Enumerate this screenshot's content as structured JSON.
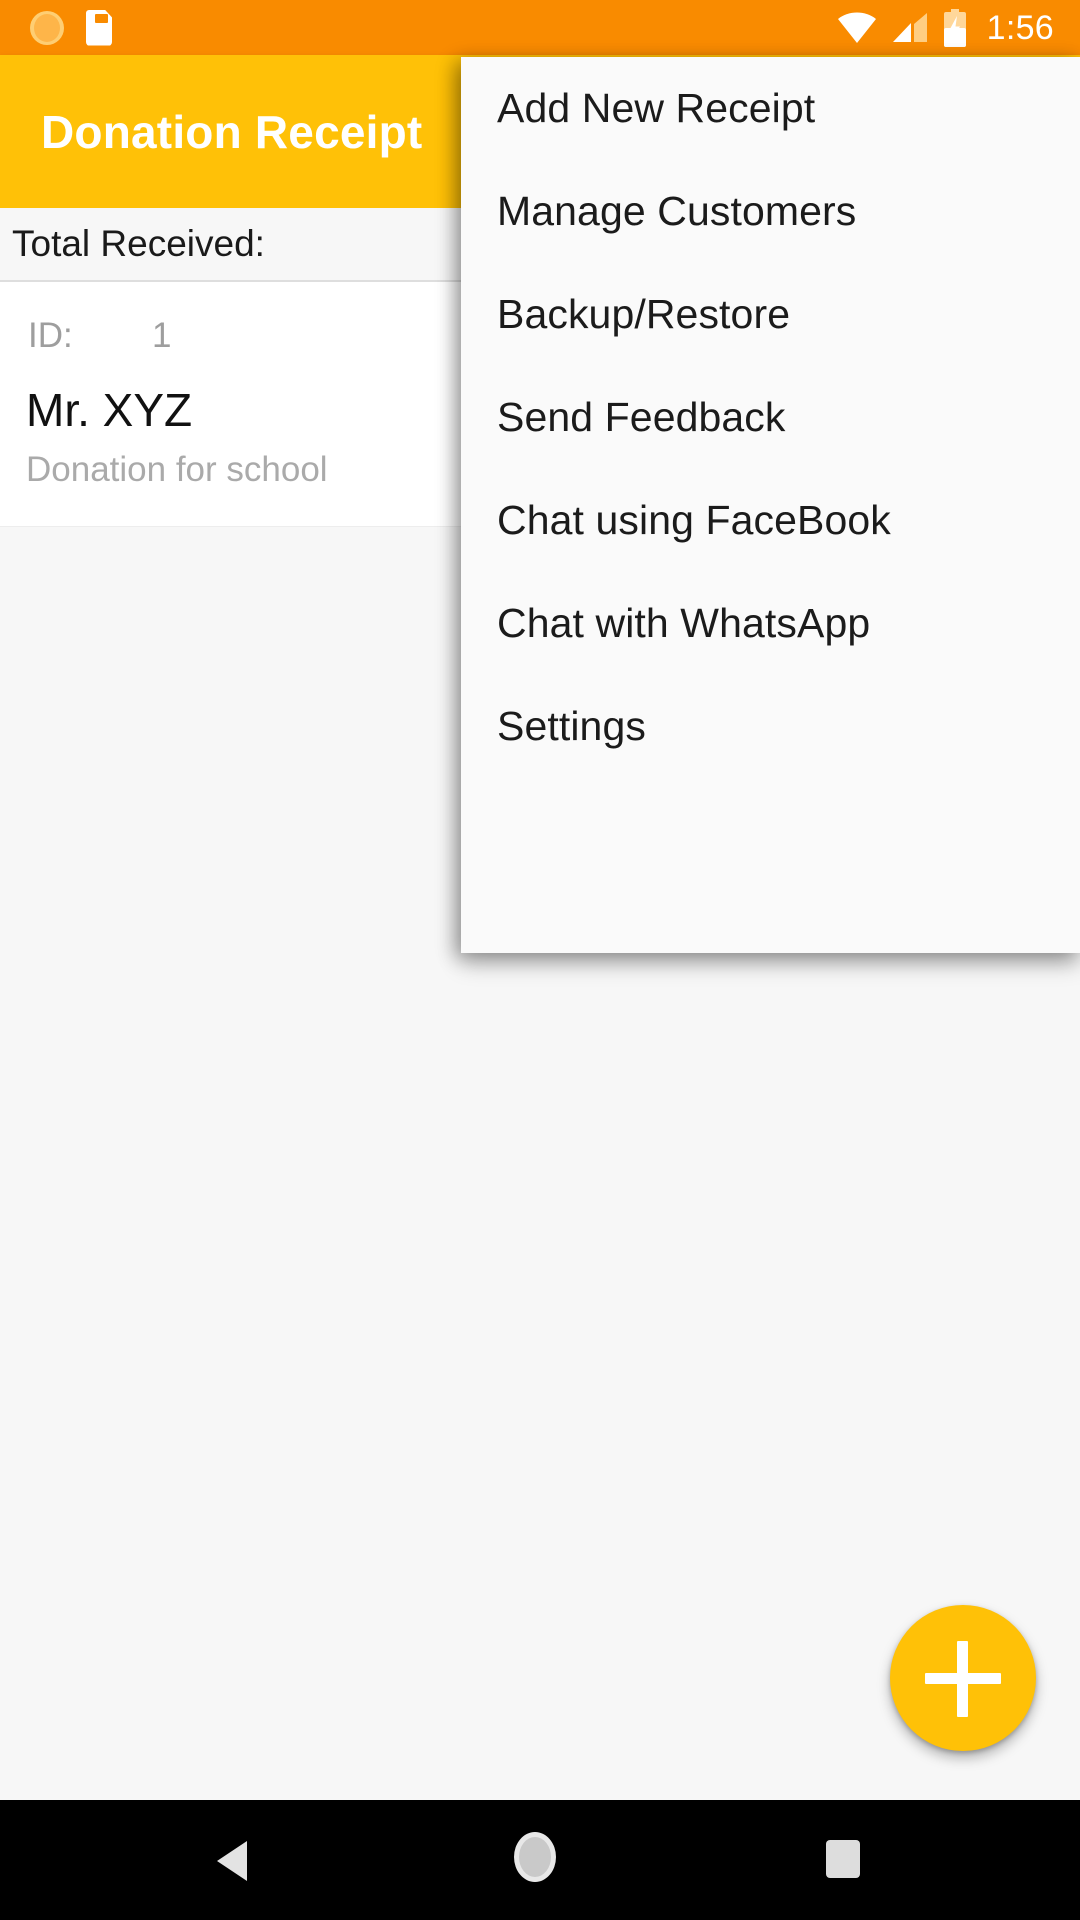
{
  "status_bar": {
    "background_color": "#F98B00",
    "time": "1:56",
    "left_icons": [
      "brightness-icon",
      "sd-card-icon"
    ],
    "right_icons": [
      "wifi-icon",
      "cell-signal-icon",
      "battery-charging-icon"
    ]
  },
  "app_bar": {
    "title": "Donation Receipt",
    "background_color": "#FFC107",
    "title_color": "#FFFFFF"
  },
  "summary": {
    "total_label": "Total Received:",
    "total_value": ""
  },
  "receipts": [
    {
      "id_label": "ID:",
      "id_value": "1",
      "name": "Mr. XYZ",
      "description": "Donation for school"
    }
  ],
  "fab": {
    "icon": "plus-icon",
    "label": "",
    "background_color": "#FFC107"
  },
  "overflow_menu": {
    "background_color": "#FAFAFA",
    "items": [
      {
        "label": "Add New Receipt"
      },
      {
        "label": "Manage Customers"
      },
      {
        "label": "Backup/Restore"
      },
      {
        "label": "Send Feedback"
      },
      {
        "label": "Chat using FaceBook"
      },
      {
        "label": "Chat with WhatsApp"
      },
      {
        "label": "Settings"
      }
    ]
  },
  "nav_bar": {
    "background_color": "#000000",
    "buttons": [
      "back-button",
      "home-button",
      "recents-button"
    ]
  }
}
